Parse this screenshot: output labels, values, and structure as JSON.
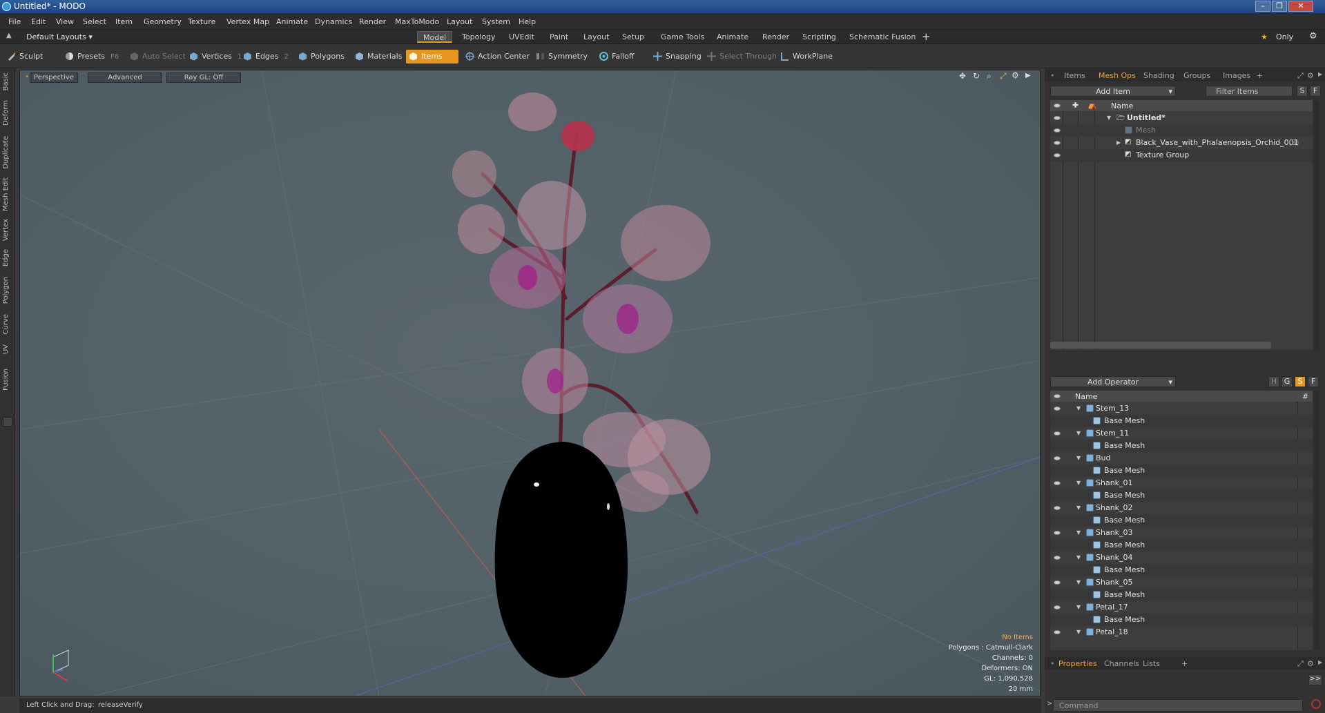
{
  "window": {
    "title": "Untitled* - MODO"
  },
  "menu": [
    "File",
    "Edit",
    "View",
    "Select",
    "Item",
    "Geometry",
    "Texture",
    "Vertex Map",
    "Animate",
    "Dynamics",
    "Render",
    "MaxToModo",
    "Layout",
    "System",
    "Help"
  ],
  "layout_bar": {
    "preset": "Default Layouts",
    "tabs": [
      "Model",
      "Topology",
      "UVEdit",
      "Paint",
      "Layout",
      "Setup",
      "Game Tools",
      "Animate",
      "Render",
      "Scripting",
      "Schematic Fusion"
    ],
    "active_tab": "Model",
    "plus": "+",
    "only": "Only"
  },
  "toolbar": {
    "sculpt": "Sculpt",
    "presets": "Presets",
    "presets_key": "F6",
    "auto_select": "Auto Select",
    "vertices": "Vertices",
    "vertices_key": "1",
    "edges": "Edges",
    "edges_key": "2",
    "polygons": "Polygons",
    "materials": "Materials",
    "items": "Items",
    "action_center": "Action Center",
    "symmetry": "Symmetry",
    "falloff": "Falloff",
    "snapping": "Snapping",
    "select_through": "Select Through",
    "workplane": "WorkPlane"
  },
  "left_tabs": [
    "Basic",
    "Deform",
    "Duplicate",
    "Mesh Edit",
    "Vertex",
    "Edge",
    "Polygon",
    "Curve",
    "UV",
    "Fusion"
  ],
  "viewport": {
    "view": "Perspective",
    "shading": "Advanced",
    "raygl": "Ray GL: Off",
    "info": {
      "no_items": "No Items",
      "polygons": "Polygons : Catmull-Clark",
      "channels": "Channels: 0",
      "deformers": "Deformers: ON",
      "gl": "GL: 1,090,528",
      "size": "20 mm"
    }
  },
  "status": {
    "hint": "Left Click and Drag:",
    "action": "releaseVerify"
  },
  "items_panel": {
    "tabs": [
      "Items",
      "Mesh Ops",
      "Shading",
      "Groups",
      "Images"
    ],
    "active_tab": "Mesh Ops",
    "add_item": "Add Item",
    "filter_placeholder": "Filter Items",
    "btn_s": "S",
    "btn_f": "F",
    "column_name": "Name",
    "tree": [
      {
        "label": "Untitled*",
        "suffix": ""
      },
      {
        "label": "Mesh",
        "suffix": ""
      },
      {
        "label": "Black_Vase_with_Phalaenopsis_Orchid_001",
        "suffix": "(3)"
      },
      {
        "label": "Texture Group",
        "suffix": ""
      }
    ]
  },
  "operator_panel": {
    "add_operator": "Add Operator",
    "btns": [
      "H",
      "G",
      "S",
      "F"
    ],
    "column_name": "Name",
    "column_hash": "#",
    "rows": [
      {
        "label": "Stem_13",
        "child": "Base Mesh"
      },
      {
        "label": "Stem_11",
        "child": "Base Mesh"
      },
      {
        "label": "Bud",
        "child": "Base Mesh"
      },
      {
        "label": "Shank_01",
        "child": "Base Mesh"
      },
      {
        "label": "Shank_02",
        "child": "Base Mesh"
      },
      {
        "label": "Shank_03",
        "child": "Base Mesh"
      },
      {
        "label": "Shank_04",
        "child": "Base Mesh"
      },
      {
        "label": "Shank_05",
        "child": "Base Mesh"
      },
      {
        "label": "Petal_17",
        "child": "Base Mesh"
      },
      {
        "label": "Petal_18",
        "child": ""
      }
    ]
  },
  "properties_panel": {
    "tabs": [
      "Properties",
      "Channels",
      "Lists"
    ],
    "active_tab": "Properties",
    "plus": "+",
    "expand": ">>",
    "command_placeholder": "Command"
  },
  "colors": {
    "accent": "#e6951e",
    "vase": "#000000",
    "petal": "#c07a9a",
    "viewport_bg": "#56636a"
  }
}
